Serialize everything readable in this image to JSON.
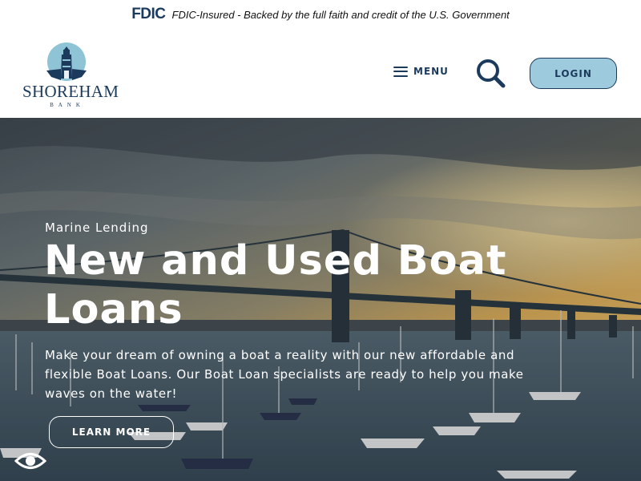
{
  "fdic": {
    "logo_text": "FDIC",
    "notice": "FDIC-Insured - Backed by the full faith and credit of the U.S. Government"
  },
  "logo": {
    "name": "SHOREHAM",
    "subtitle": "BANK"
  },
  "nav": {
    "menu_label": "MENU",
    "search_icon": "search-icon",
    "login_label": "LOGIN"
  },
  "hero": {
    "eyebrow": "Marine Lending",
    "title": "New and Used Boat Loans",
    "description": "Make your dream of owning a boat a reality with our new affordable and flexible Boat Loans. Our Boat Loan specialists are ready to help you make waves on the water!",
    "cta_label": "LEARN MORE"
  },
  "accessibility": {
    "icon": "eye-icon"
  },
  "colors": {
    "brand_navy": "#1b3a5c",
    "login_fill": "#9dcbdd",
    "hero_text": "#ffffff"
  }
}
